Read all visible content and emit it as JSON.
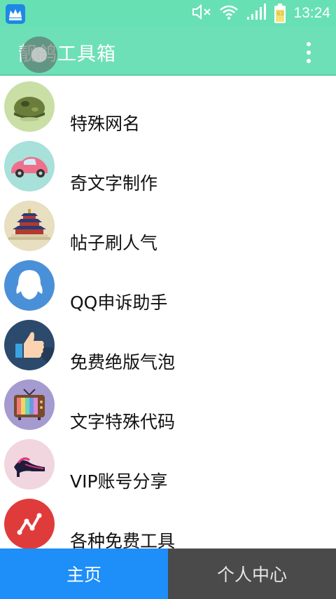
{
  "status_bar": {
    "time": "13:24",
    "battery_level": "63",
    "icons": [
      "crown-app-icon",
      "mute-icon",
      "wifi-icon",
      "signal-icon",
      "battery-icon"
    ]
  },
  "app_bar": {
    "title": "靓鸽工具箱",
    "menu_icon": "more-vert-icon"
  },
  "list": {
    "items": [
      {
        "label": "特殊网名",
        "icon": "helmet-icon",
        "bg": "#c9dfa6"
      },
      {
        "label": "奇文字制作",
        "icon": "car-icon",
        "bg": "#a8e0da"
      },
      {
        "label": "帖子刷人气",
        "icon": "temple-icon",
        "bg": "#e8dec0"
      },
      {
        "label": "QQ申诉助手",
        "icon": "qq-penguin-icon",
        "bg": "#4a90d9"
      },
      {
        "label": "免费绝版气泡",
        "icon": "thumbs-up-icon",
        "bg": "#2c4a6b"
      },
      {
        "label": "文字特殊代码",
        "icon": "tv-icon",
        "bg": "#a59bd0"
      },
      {
        "label": "VIP账号分享",
        "icon": "high-heel-icon",
        "bg": "#f1d5df"
      },
      {
        "label": "各种免费工具",
        "icon": "chart-line-icon",
        "bg": "#e03b3b"
      }
    ]
  },
  "tabs": {
    "home": "主页",
    "profile": "个人中心"
  },
  "colors": {
    "status_bar": "#67e0b4",
    "app_bar": "#6ee0b8",
    "tab_active": "#1e8ef8",
    "tab_inactive": "#4a4a4a"
  }
}
